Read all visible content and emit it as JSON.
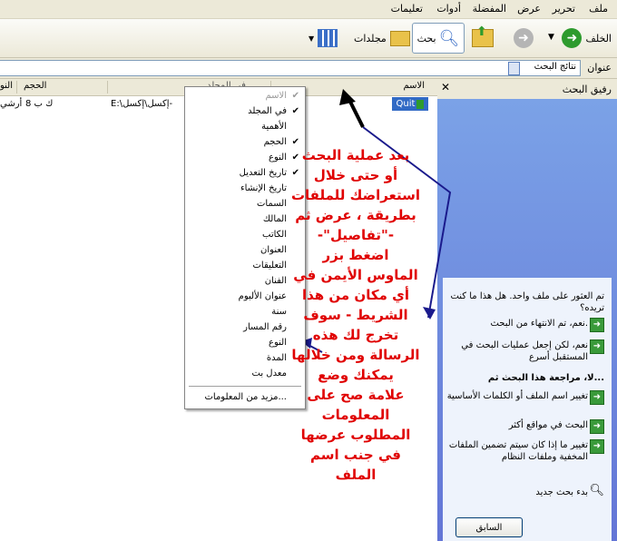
{
  "menu": {
    "file": "ملف",
    "edit": "تحرير",
    "view": "عرض",
    "favorites": "المفضلة",
    "tools": "أدوات",
    "help": "تعليمات"
  },
  "toolbar": {
    "back": "الخلف",
    "search": "بحث",
    "folders": "مجلدات"
  },
  "address": {
    "label": "عنوان",
    "value": "نتائج البحث"
  },
  "pane": {
    "title": "رفيق البحث",
    "close": "✕",
    "question": "تم العثور على ملف واحد. هل هذا ما كنت تريده؟",
    "options": [
      "نعم، تم الانتهاء من البحث.",
      "نعم، لكن إجعل عمليات البحث في المستقبل أسرع"
    ],
    "refine_title": "لا، مراجعة هذا البحث ثم...",
    "refine": [
      "تغيير اسم الملف أو الكلمات الأساسية",
      "البحث في مواقع أكثر",
      "تغيير ما إذا كان سيتم تضمين الملفات المخفية وملفات النظام"
    ],
    "new_search": "بدء بحث جديد",
    "back_button": "السابق"
  },
  "columns": {
    "name": "الاسم",
    "folder": "في المجلد",
    "size": "الحجم",
    "type": "النو"
  },
  "file_row": {
    "name": "Quit",
    "folder": "E:\\إكسل\\إكسل-",
    "size": "ك ب 8",
    "type": "أرشي"
  },
  "context_menu": {
    "items": [
      {
        "label": "الاسم",
        "checked": true,
        "disabled": true
      },
      {
        "label": "في المجلد",
        "checked": true
      },
      {
        "label": "الأهمية",
        "checked": false
      },
      {
        "label": "الحجم",
        "checked": true
      },
      {
        "label": "النوع",
        "checked": true
      },
      {
        "label": "تاريخ التعديل",
        "checked": true
      },
      {
        "label": "تاريخ الإنشاء",
        "checked": false
      },
      {
        "label": "السمات",
        "checked": false
      },
      {
        "label": "المالك",
        "checked": false
      },
      {
        "label": "الكاتب",
        "checked": false
      },
      {
        "label": "العنوان",
        "checked": false
      },
      {
        "label": "التعليقات",
        "checked": false
      },
      {
        "label": "الفنان",
        "checked": false
      },
      {
        "label": "عنوان الألبوم",
        "checked": false
      },
      {
        "label": "سنة",
        "checked": false
      },
      {
        "label": "رقم المسار",
        "checked": false
      },
      {
        "label": "النوع",
        "checked": false
      },
      {
        "label": "المدة",
        "checked": false
      },
      {
        "label": "معدل بت",
        "checked": false
      }
    ],
    "more": "مزيد من المعلومات..."
  },
  "annotation": {
    "lines": [
      "بعد عملية البحث",
      "أو حتى خلال",
      "استعراضك للملفات",
      "بطريقة ، عرض ثم",
      "-\"تفاصيل\"-",
      "اضغط بزر",
      "الماوس الأيمن في",
      "أي مكان من هذا",
      "الشريط - سوف",
      "تخرج لك هذه",
      "الرسالة ومن خلالها",
      "يمكنك وضع",
      "علامة صح على",
      "المعلومات",
      "المطلوب عرضها",
      "في جنب اسم",
      "الملف"
    ]
  },
  "colors": {
    "annotation": "#e00000",
    "arrow_blue": "#1a1a8c",
    "pane_blue": "#6f8fe0"
  }
}
